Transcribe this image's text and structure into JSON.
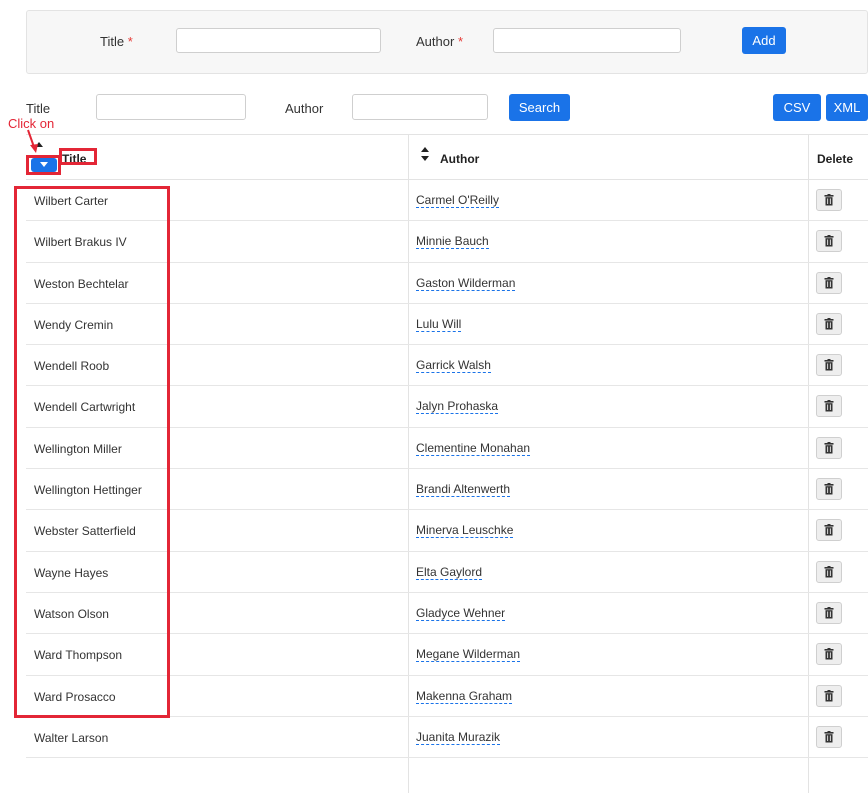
{
  "add_form": {
    "title_label": "Title",
    "author_label": "Author",
    "required_mark": "*",
    "title_value": "",
    "author_value": "",
    "add_button": "Add"
  },
  "search_form": {
    "title_label": "Title",
    "author_label": "Author",
    "title_value": "",
    "author_value": "",
    "search_button": "Search",
    "csv_button": "CSV",
    "xml_button": "XML"
  },
  "table": {
    "headers": {
      "title": "Title",
      "author": "Author",
      "delete": "Delete"
    },
    "rows": [
      {
        "title": "Wilbert Carter",
        "author": "Carmel O'Reilly"
      },
      {
        "title": "Wilbert Brakus IV",
        "author": "Minnie Bauch"
      },
      {
        "title": "Weston Bechtelar",
        "author": "Gaston Wilderman"
      },
      {
        "title": "Wendy Cremin",
        "author": "Lulu Will"
      },
      {
        "title": "Wendell Roob",
        "author": "Garrick Walsh"
      },
      {
        "title": "Wendell Cartwright",
        "author": "Jalyn Prohaska"
      },
      {
        "title": "Wellington Miller",
        "author": "Clementine Monahan"
      },
      {
        "title": "Wellington Hettinger",
        "author": "Brandi Altenwerth"
      },
      {
        "title": "Webster Satterfield",
        "author": "Minerva Leuschke"
      },
      {
        "title": "Wayne Hayes",
        "author": "Elta Gaylord"
      },
      {
        "title": "Watson Olson",
        "author": "Gladyce Wehner"
      },
      {
        "title": "Ward Thompson",
        "author": "Megane Wilderman"
      },
      {
        "title": "Ward Prosacco",
        "author": "Makenna Graham"
      },
      {
        "title": "Walter Larson",
        "author": "Juanita Murazik"
      }
    ]
  },
  "annotation": {
    "click_on": "Click on"
  },
  "colors": {
    "primary": "#1a73e8",
    "annotation": "#e32636",
    "required": "#e53935"
  },
  "icons": {
    "delete": "trash-icon",
    "sort_up": "caret-up-icon",
    "sort_down": "caret-down-icon"
  }
}
